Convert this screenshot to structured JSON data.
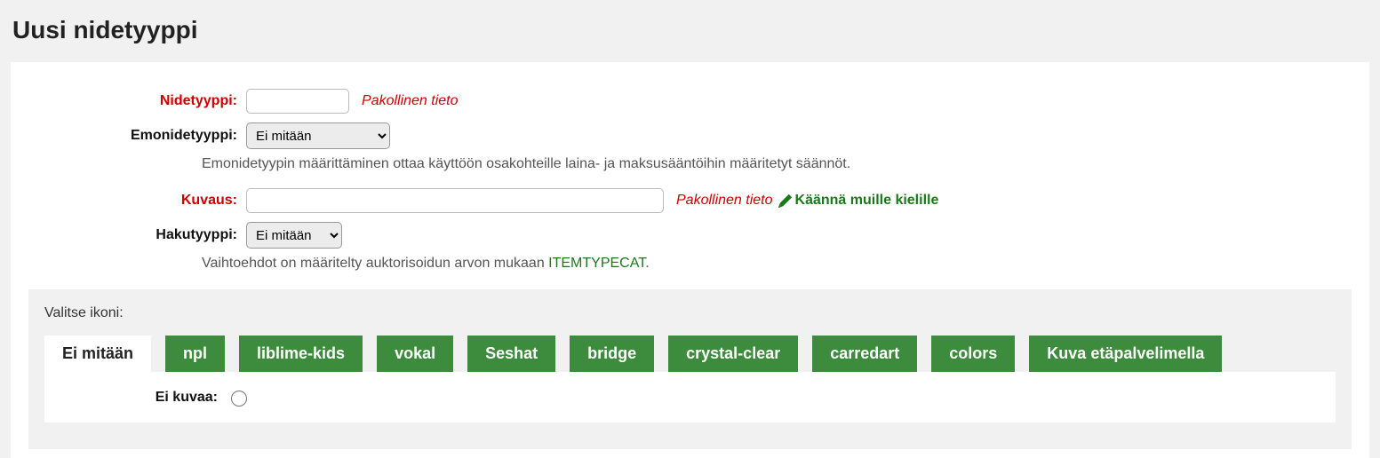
{
  "page_title": "Uusi nidetyyppi",
  "form": {
    "itemtype": {
      "label": "Nidetyyppi:",
      "value": "",
      "required_note": "Pakollinen tieto"
    },
    "parent": {
      "label": "Emonidetyyppi:",
      "selected": "Ei mitään",
      "hint": "Emonidetyypin määrittäminen ottaa käyttöön osakohteille laina- ja maksusääntöihin määritetyt säännöt."
    },
    "description": {
      "label": "Kuvaus:",
      "value": "",
      "required_note": "Pakollinen tieto",
      "translate_label": "Käännä muille kielille"
    },
    "searchtype": {
      "label": "Hakutyyppi:",
      "selected": "Ei mitään",
      "hint_prefix": "Vaihtoehdot on määritelty auktorisoidun arvon mukaan ",
      "hint_link": "ITEMTYPECAT",
      "hint_suffix": "."
    }
  },
  "icon_section": {
    "title": "Valitse ikoni:",
    "tabs": [
      "Ei mitään",
      "npl",
      "liblime-kids",
      "vokal",
      "Seshat",
      "bridge",
      "crystal-clear",
      "carredart",
      "colors",
      "Kuva etäpalvelimella"
    ],
    "active_tab_index": 0,
    "no_image_label": "Ei kuvaa:"
  }
}
